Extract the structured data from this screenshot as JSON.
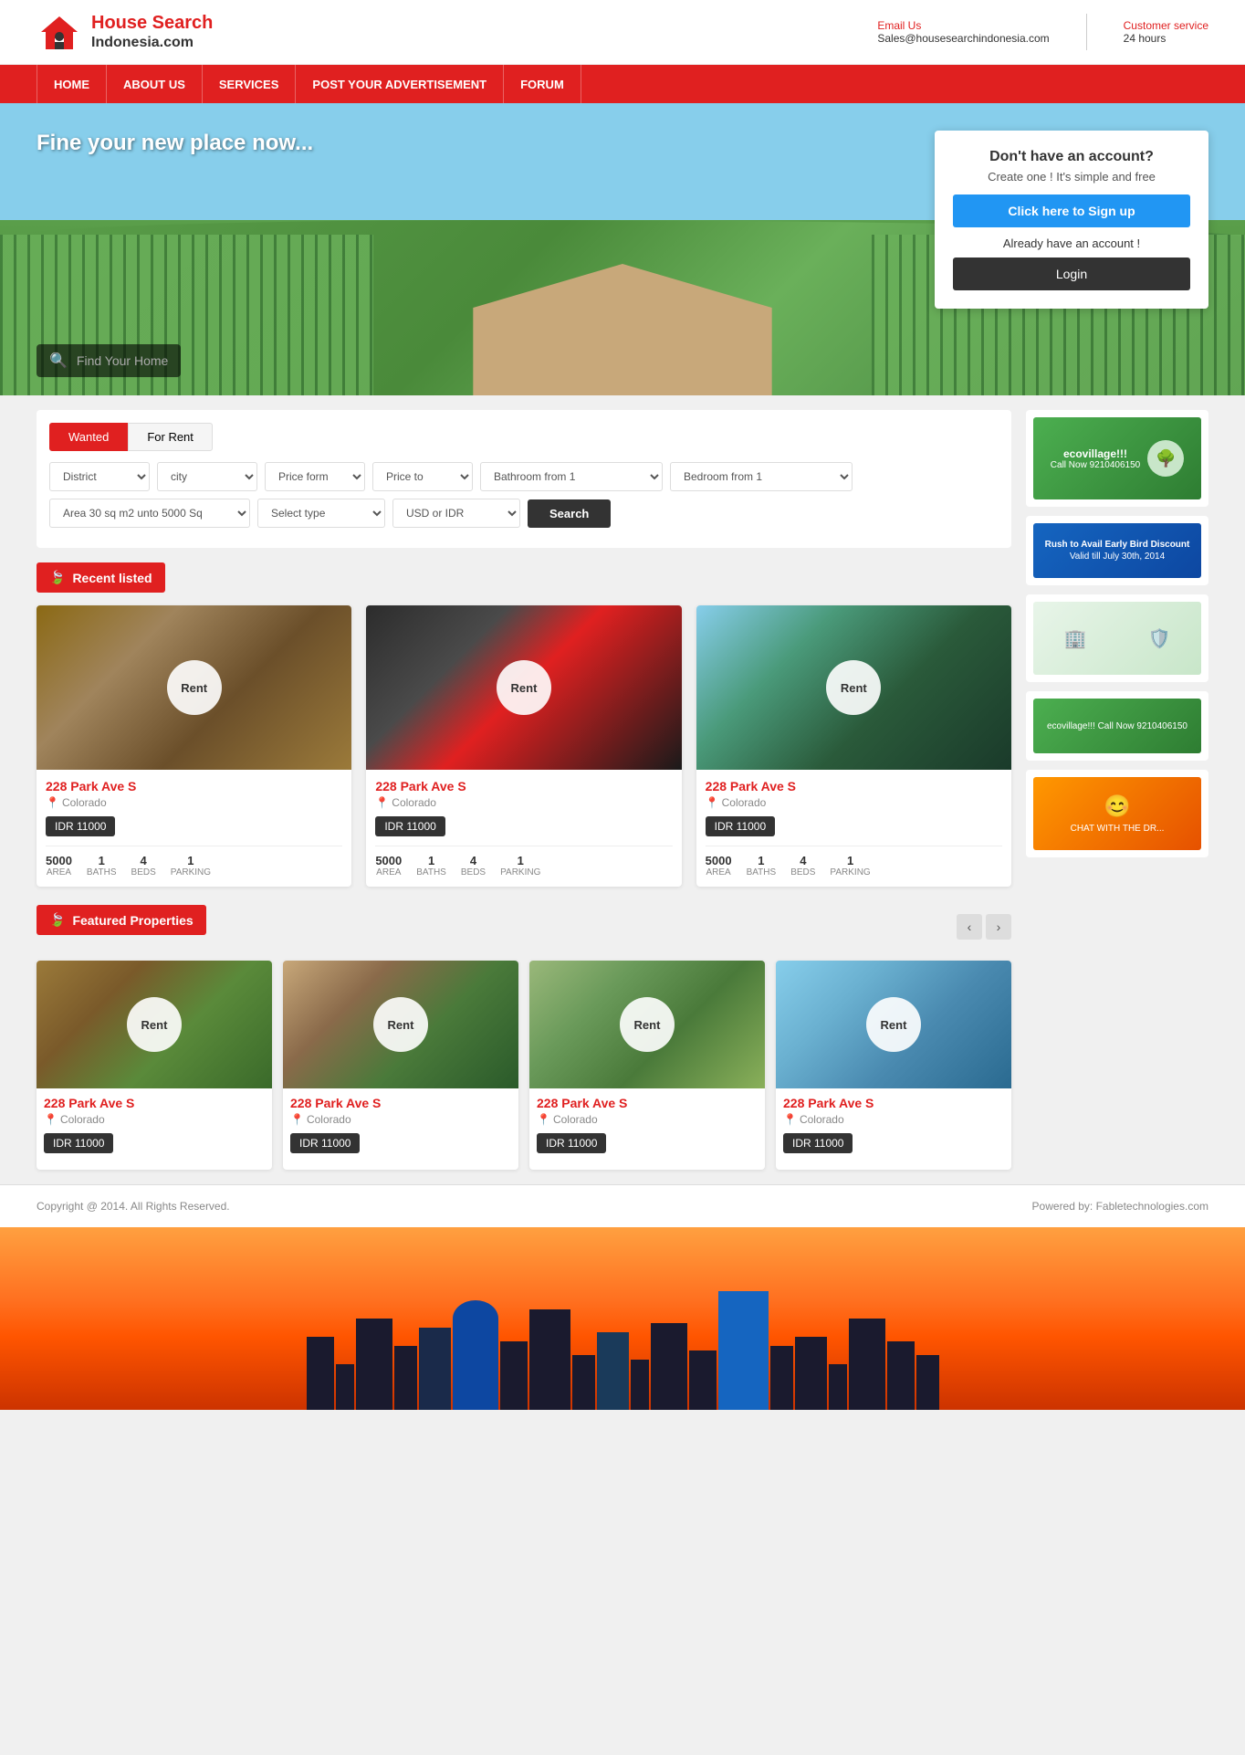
{
  "header": {
    "logo_house": "House Search",
    "logo_indonesia": "Indonesia.com",
    "email_label": "Email Us",
    "email_value": "Sales@housesearchindonesia.com",
    "customer_label": "Customer service",
    "customer_value": "24 hours"
  },
  "nav": {
    "items": [
      "HOME",
      "ABOUT US",
      "SERVICES",
      "POST YOUR ADVERTISEMENT",
      "FORUM"
    ]
  },
  "hero": {
    "tagline": "Fine your new place now...",
    "signup_title": "Don't have an account?",
    "signup_sub": "Create one ! It's simple and free",
    "signup_btn": "Click here to Sign up",
    "account_text": "Already have an account !",
    "login_btn": "Login",
    "search_placeholder": "Find Your Home"
  },
  "search_form": {
    "tab_wanted": "Wanted",
    "tab_for_rent": "For Rent",
    "district_label": "District",
    "city_label": "city",
    "price_from_label": "Price form",
    "price_to_label": "Price to",
    "bathroom_label": "Bathroom from 1",
    "bedroom_label": "Bedroom from 1",
    "area_label": "Area 30 sq m2 unto 5000 Sq",
    "select_type_label": "Select type",
    "currency_label": "USD or IDR",
    "search_btn": "Search"
  },
  "recent_section": {
    "title": "Recent listed"
  },
  "featured_section": {
    "title": "Featured Properties"
  },
  "properties": [
    {
      "badge": "Rent",
      "address": "228 Park Ave S",
      "location": "Colorado",
      "price": "IDR  11000",
      "area": "5000",
      "baths": "1",
      "beds": "4",
      "parking": "1",
      "img_class": "img-bedroom1"
    },
    {
      "badge": "Rent",
      "address": "228 Park Ave S",
      "location": "Colorado",
      "price": "IDR  11000",
      "area": "5000",
      "baths": "1",
      "beds": "4",
      "parking": "1",
      "img_class": "img-bedroom2"
    },
    {
      "badge": "Rent",
      "address": "228 Park Ave S",
      "location": "Colorado",
      "price": "IDR  11000",
      "area": "5000",
      "baths": "1",
      "beds": "4",
      "parking": "1",
      "img_class": "img-bedroom3"
    }
  ],
  "featured_properties": [
    {
      "badge": "Rent",
      "address": "228 Park Ave S",
      "location": "Colorado",
      "price": "IDR  11000",
      "img_class": "img-house1"
    },
    {
      "badge": "Rent",
      "address": "228 Park Ave S",
      "location": "Colorado",
      "price": "IDR  11000",
      "img_class": "img-house2"
    },
    {
      "badge": "Rent",
      "address": "228 Park Ave S",
      "location": "Colorado",
      "price": "IDR  11000",
      "img_class": "img-house3"
    },
    {
      "badge": "Rent",
      "address": "228 Park Ave S",
      "location": "Colorado",
      "price": "IDR  11000",
      "img_class": "img-house4"
    }
  ],
  "footer": {
    "copyright": "Copyright @ 2014. All Rights Reserved.",
    "powered": "Powered by: Fabletechnologies.com"
  },
  "stats_labels": {
    "area": "AREA",
    "baths": "BATHS",
    "beds": "BEDS",
    "parking": "PARKING"
  },
  "colors": {
    "accent": "#e02020",
    "dark": "#333333",
    "blue_btn": "#2196f3"
  }
}
